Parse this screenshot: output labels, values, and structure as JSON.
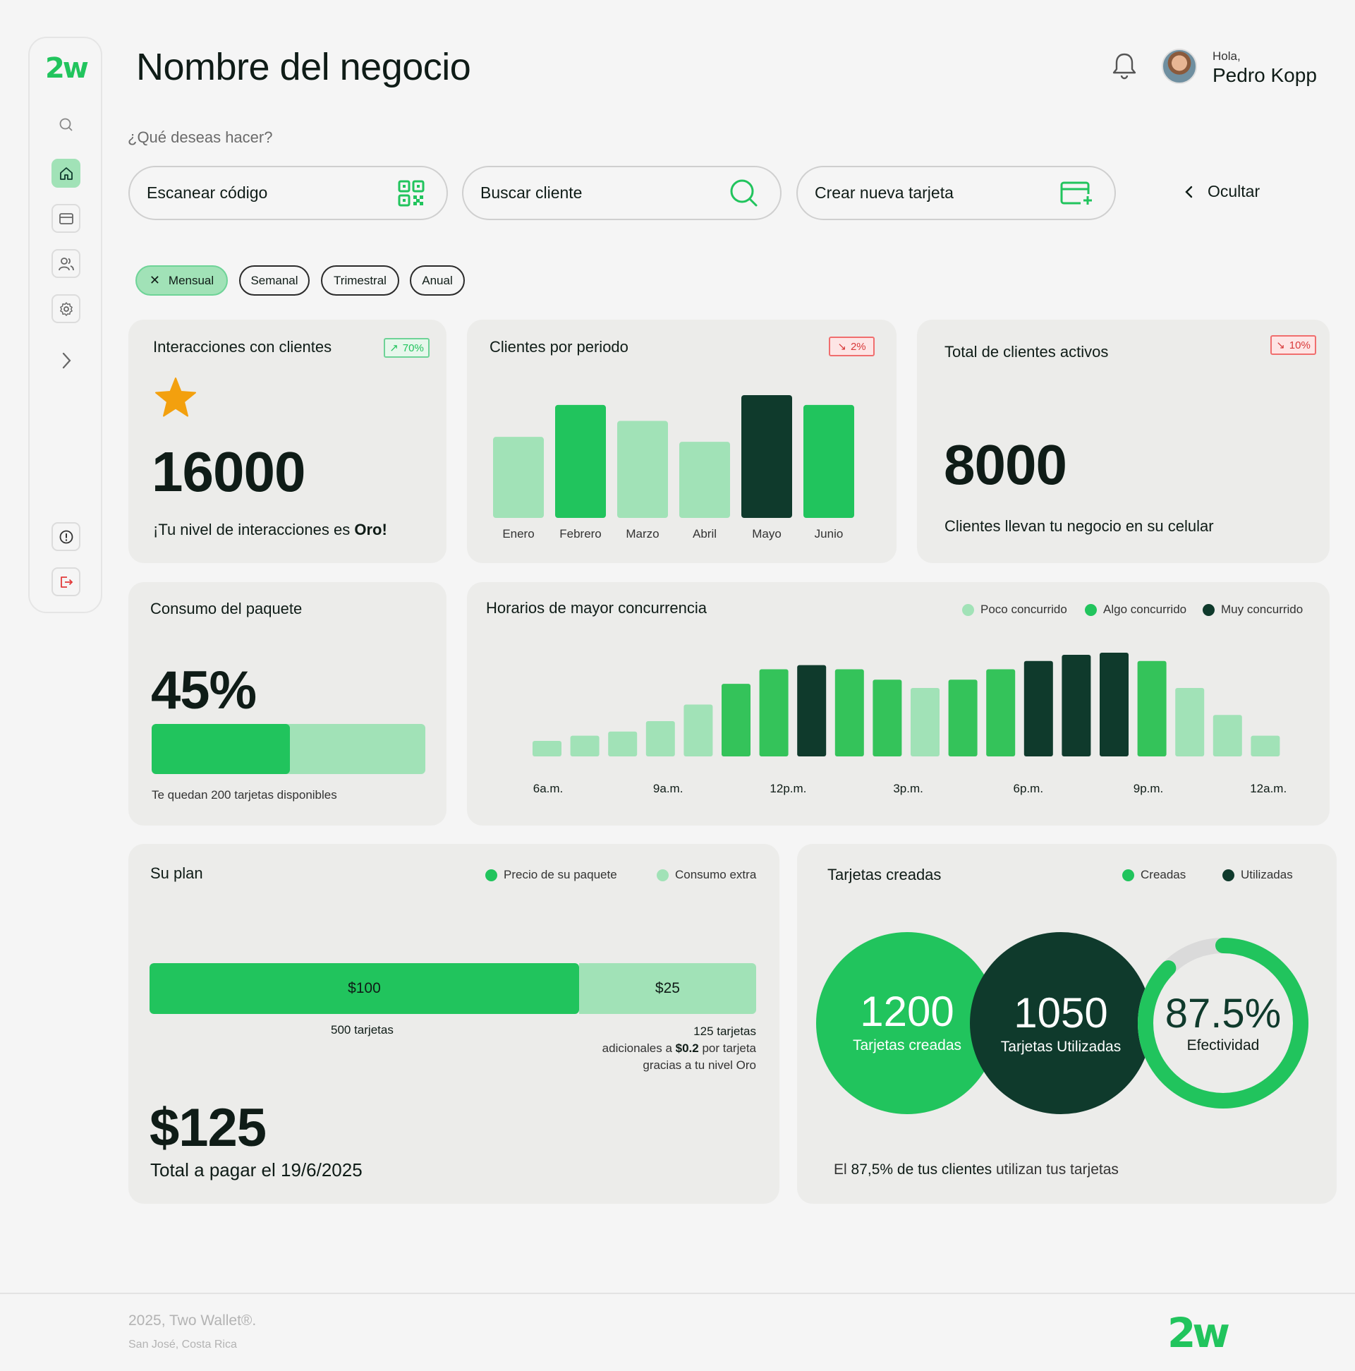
{
  "brand": {
    "logo": "2w",
    "green": "#21c45d",
    "light_green": "#a1e2b7",
    "mid_green": "#34c35a",
    "dark_green": "#0f3a2c"
  },
  "sidebar": {
    "items": [
      {
        "icon": "search-icon"
      },
      {
        "icon": "home-icon",
        "active": true
      },
      {
        "icon": "card-icon"
      },
      {
        "icon": "users-icon"
      },
      {
        "icon": "gear-icon"
      },
      {
        "icon": "chevron-right-icon"
      },
      {
        "icon": "alert-icon"
      },
      {
        "icon": "logout-icon"
      }
    ]
  },
  "header": {
    "title": "Nombre del negocio",
    "greeting": "Hola,",
    "user_name": "Pedro Kopp"
  },
  "actions": {
    "question": "¿Qué deseas hacer?",
    "scan": "Escanear código",
    "search": "Buscar cliente",
    "create": "Crear nueva tarjeta",
    "hide": "Ocultar"
  },
  "filters": {
    "monthly": "Mensual",
    "weekly": "Semanal",
    "quarterly": "Trimestral",
    "yearly": "Anual",
    "selected": "Mensual"
  },
  "interactions": {
    "title": "Interacciones con clientes",
    "badge": "70%",
    "value": "16000",
    "note_prefix": "¡Tu nivel de interacciones es ",
    "note_level": "Oro!"
  },
  "clients_period": {
    "title": "Clientes por periodo",
    "badge": "2%"
  },
  "active_clients": {
    "title": "Total de clientes activos",
    "badge": "10%",
    "value": "8000",
    "note": "Clientes llevan tu negocio en su celular"
  },
  "package": {
    "title": "Consumo del paquete",
    "value": "45%",
    "progress": 0.45,
    "note": "Te quedan 200 tarjetas disponibles"
  },
  "busy_hours": {
    "title": "Horarios de mayor concurrencia",
    "legend": {
      "low": "Poco concurrido",
      "mid": "Algo concurrido",
      "high": "Muy concurrido"
    }
  },
  "plan": {
    "title": "Su plan",
    "legend_base": "Precio de su paquete",
    "legend_extra": "Consumo extra",
    "base_label": "$100",
    "extra_label": "$25",
    "base_value": 100,
    "extra_value": 25,
    "base_note": "500 tarjetas",
    "extra_note_1": "125 tarjetas",
    "extra_note_2_prefix": "adicionales a ",
    "extra_note_2_price": "$0.2",
    "extra_note_2_suffix": " por tarjeta",
    "extra_note_3": "gracias a tu nivel Oro",
    "total": "$125",
    "total_note": "Total a pagar el 19/6/2025"
  },
  "cards_created": {
    "title": "Tarjetas creadas",
    "legend_created": "Creadas",
    "legend_used": "Utilizadas",
    "created_value": "1200",
    "created_label": "Tarjetas creadas",
    "used_value": "1050",
    "used_label": "Tarjetas Utilizadas",
    "rate_value": "87.5%",
    "rate_label": "Efectividad",
    "rate_fraction": 0.875,
    "note_prefix": "El ",
    "note_bold": "87,5% de tus clientes",
    "note_suffix": " utilizan tus tarjetas"
  },
  "footer": {
    "copyright": "2025, Two Wallet®.",
    "location": "San José, Costa Rica",
    "logo": "2w"
  },
  "chart_data": [
    {
      "type": "bar",
      "title": "Clientes por periodo",
      "categories": [
        "Enero",
        "Febrero",
        "Marzo",
        "Abril",
        "Mayo",
        "Junio"
      ],
      "values": [
        66,
        92,
        79,
        62,
        100,
        92
      ],
      "levels": [
        "low",
        "mid",
        "low",
        "low",
        "high",
        "mid"
      ]
    },
    {
      "type": "bar",
      "title": "Horarios de mayor concurrencia",
      "tick_labels": [
        "6a.m.",
        "9a.m.",
        "12p.m.",
        "3p.m.",
        "6p.m.",
        "9p.m.",
        "12a.m."
      ],
      "values": [
        15,
        20,
        24,
        34,
        50,
        70,
        84,
        88,
        84,
        74,
        66,
        74,
        84,
        92,
        98,
        100,
        92,
        66,
        40,
        20
      ],
      "levels": [
        "low",
        "low",
        "low",
        "low",
        "low",
        "mid",
        "mid",
        "high",
        "mid",
        "mid",
        "low",
        "mid",
        "mid",
        "high",
        "high",
        "high",
        "mid",
        "low",
        "low",
        "low"
      ]
    }
  ]
}
